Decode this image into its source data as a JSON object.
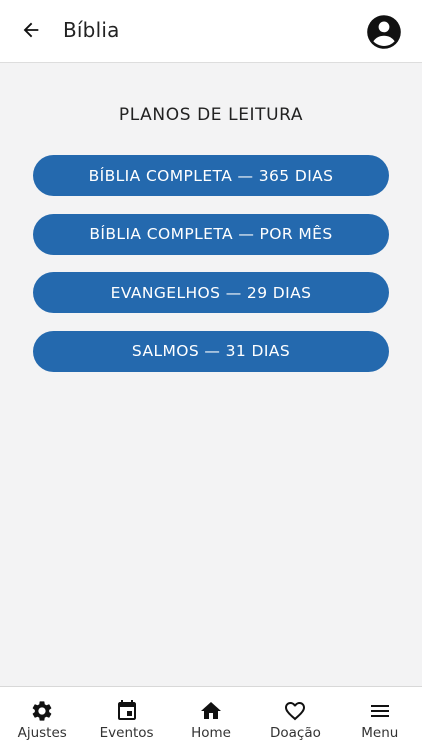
{
  "header": {
    "title": "Bíblia",
    "back_icon": "arrow-left-icon",
    "profile_icon": "account-circle-icon"
  },
  "main": {
    "section_title": "PLANOS DE LEITURA",
    "plans": [
      {
        "label": "BÍBLIA COMPLETA — 365 DIAS"
      },
      {
        "label": "BÍBLIA COMPLETA — POR MÊS"
      },
      {
        "label": "EVANGELHOS — 29 DIAS"
      },
      {
        "label": "SALMOS — 31 DIAS"
      }
    ]
  },
  "bottom_nav": {
    "items": [
      {
        "label": "Ajustes",
        "icon": "gear-icon"
      },
      {
        "label": "Eventos",
        "icon": "calendar-icon"
      },
      {
        "label": "Home",
        "icon": "home-icon"
      },
      {
        "label": "Doação",
        "icon": "heart-icon"
      },
      {
        "label": "Menu",
        "icon": "hamburger-menu-icon"
      }
    ]
  },
  "colors": {
    "accent": "#2469ae",
    "background": "#f3f3f4",
    "header_background": "#ffffff"
  }
}
